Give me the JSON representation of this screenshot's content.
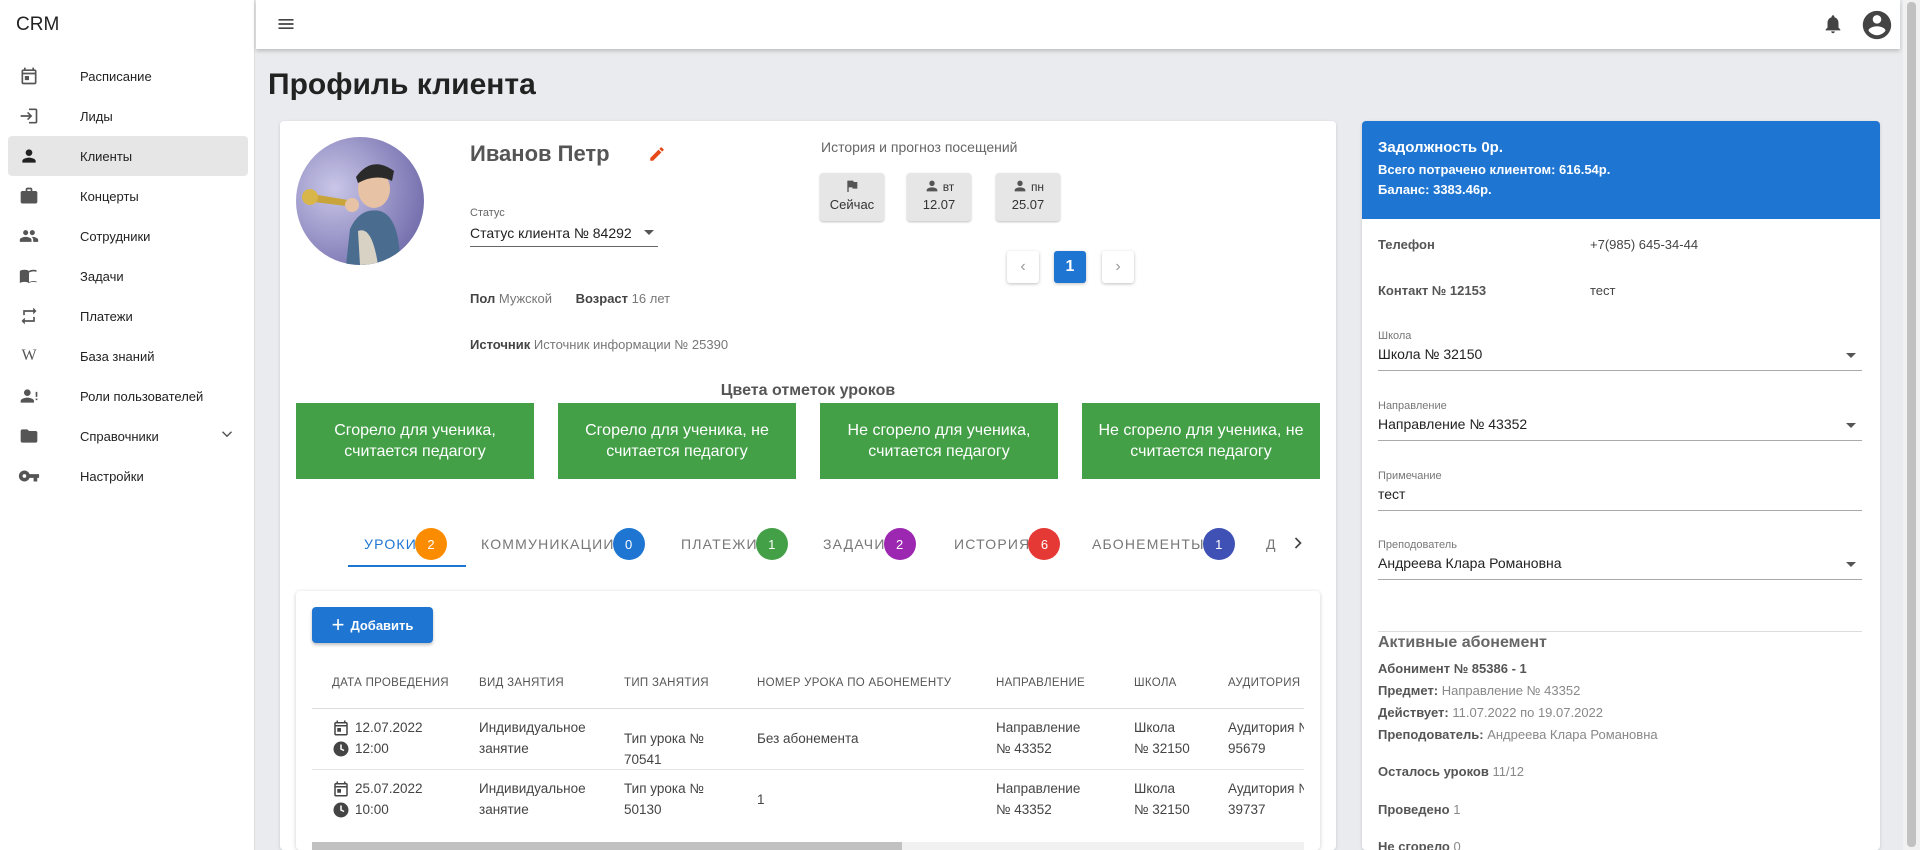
{
  "app": {
    "brand": "CRM"
  },
  "sidebar": {
    "items": [
      {
        "label": "Расписание",
        "icon": "calendar-icon"
      },
      {
        "label": "Лиды",
        "icon": "login-icon"
      },
      {
        "label": "Клиенты",
        "icon": "person-icon",
        "active": true
      },
      {
        "label": "Концерты",
        "icon": "briefcase-icon"
      },
      {
        "label": "Сотрудники",
        "icon": "people-icon"
      },
      {
        "label": "Задачи",
        "icon": "book-icon"
      },
      {
        "label": "Платежи",
        "icon": "repeat-icon"
      },
      {
        "label": "База знаний",
        "icon": "wikipedia-icon"
      },
      {
        "label": "Роли пользователей",
        "icon": "person-alert-icon"
      },
      {
        "label": "Справочники",
        "icon": "folder-icon",
        "expandable": true
      },
      {
        "label": "Настройки",
        "icon": "key-icon"
      }
    ]
  },
  "page": {
    "title": "Профиль клиента"
  },
  "client": {
    "name": "Иванов Петр",
    "status_label": "Статус",
    "status_value": "Статус клиента № 84292",
    "gender_key": "Пол",
    "gender_value": "Мужской",
    "age_key": "Возраст",
    "age_value": "16 лет",
    "source_key": "Источник",
    "source_value": "Источник информации № 25390"
  },
  "visits": {
    "title": "История и прогноз посещений",
    "chips": [
      {
        "icon": "flag-icon",
        "top": "",
        "bottom": "Сейчас"
      },
      {
        "icon": "person-icon",
        "top": "вт",
        "bottom": "12.07"
      },
      {
        "icon": "person-icon",
        "top": "пн",
        "bottom": "25.07"
      }
    ],
    "pager": {
      "prev": "‹",
      "current": "1",
      "next": "›"
    }
  },
  "lesson_colors": {
    "title": "Цвета отметок уроков",
    "boxes": [
      "Сгорело для ученика, считается педагогу",
      "Сгорело для ученика, не считается педагогу",
      "Не сгорело для ученика, считается педагогу",
      "Не сгорело для ученика, не считается педагогу"
    ],
    "color": "#43a047"
  },
  "tabs": [
    {
      "label": "УРОКИ",
      "count": "2",
      "color": "#fb8c00",
      "active": true
    },
    {
      "label": "КОММУНИКАЦИИ",
      "count": "0",
      "color": "#1e76d2"
    },
    {
      "label": "ПЛАТЕЖИ",
      "count": "1",
      "color": "#43a047"
    },
    {
      "label": "ЗАДАЧИ",
      "count": "2",
      "color": "#9c27b0"
    },
    {
      "label": "ИСТОРИЯ",
      "count": "6",
      "color": "#e53935"
    },
    {
      "label": "АБОНЕМЕНТЫ",
      "count": "1",
      "color": "#3f51b5"
    },
    {
      "label": "Д",
      "count": "",
      "color": ""
    }
  ],
  "lessons": {
    "add_label": "Добавить",
    "headers": [
      "ДАТА ПРОВЕДЕНИЯ",
      "ВИД ЗАНЯТИЯ",
      "ТИП ЗАНЯТИЯ",
      "НОМЕР УРОКА ПО АБОНЕМЕНТУ",
      "НАПРАВЛЕНИЕ",
      "ШКОЛА",
      "АУДИТОРИЯ"
    ],
    "rows": [
      {
        "date": "12.07.2022",
        "time": "12:00",
        "kind": [
          "Индивидуальное",
          "занятие"
        ],
        "type": [
          "Тип урока №",
          "70541"
        ],
        "number": "Без абонемента",
        "direction": [
          "Направление",
          "№ 43352"
        ],
        "school": [
          "Школа",
          "№ 32150"
        ],
        "room": [
          "Аудитория №",
          "95679"
        ]
      },
      {
        "date": "25.07.2022",
        "time": "10:00",
        "kind": [
          "Индивидуальное",
          "занятие"
        ],
        "type": [
          "Тип урока №",
          "50130"
        ],
        "number": "1",
        "direction": [
          "Направление",
          "№ 43352"
        ],
        "school": [
          "Школа",
          "№ 32150"
        ],
        "room": [
          "Аудитория №",
          "39737"
        ]
      }
    ]
  },
  "account": {
    "debt_title": "Задолжность 0р.",
    "spent": "Всего потрачено клиентом: 616.54р.",
    "balance": "Баланс: 3383.46р.",
    "phone_key": "Телефон",
    "phone_value": "+7(985) 645-34-44",
    "contact_key": "Контакт № 12153",
    "contact_value": "тест",
    "school_label": "Школа",
    "school_value": "Школа № 32150",
    "direction_label": "Направление",
    "direction_value": "Направление № 43352",
    "note_label": "Примечание",
    "note_value": "тест",
    "teacher_label": "Преподователь",
    "teacher_value": "Андреева Клара Романовна"
  },
  "subscription": {
    "title": "Активные абонемент",
    "name": "Абонимент № 85386 - 1",
    "subject_key": "Предмет:",
    "subject_value": "Направление № 43352",
    "valid_key": "Действует:",
    "valid_value": "11.07.2022 по 19.07.2022",
    "teacher_key": "Преподователь:",
    "teacher_value": "Андреева Клара Романовна",
    "left_key": "Осталось уроков",
    "left_value": "11/12",
    "done_key": "Проведено",
    "done_value": "1",
    "notburned_key": "Не сгорело",
    "notburned_value": "0"
  }
}
